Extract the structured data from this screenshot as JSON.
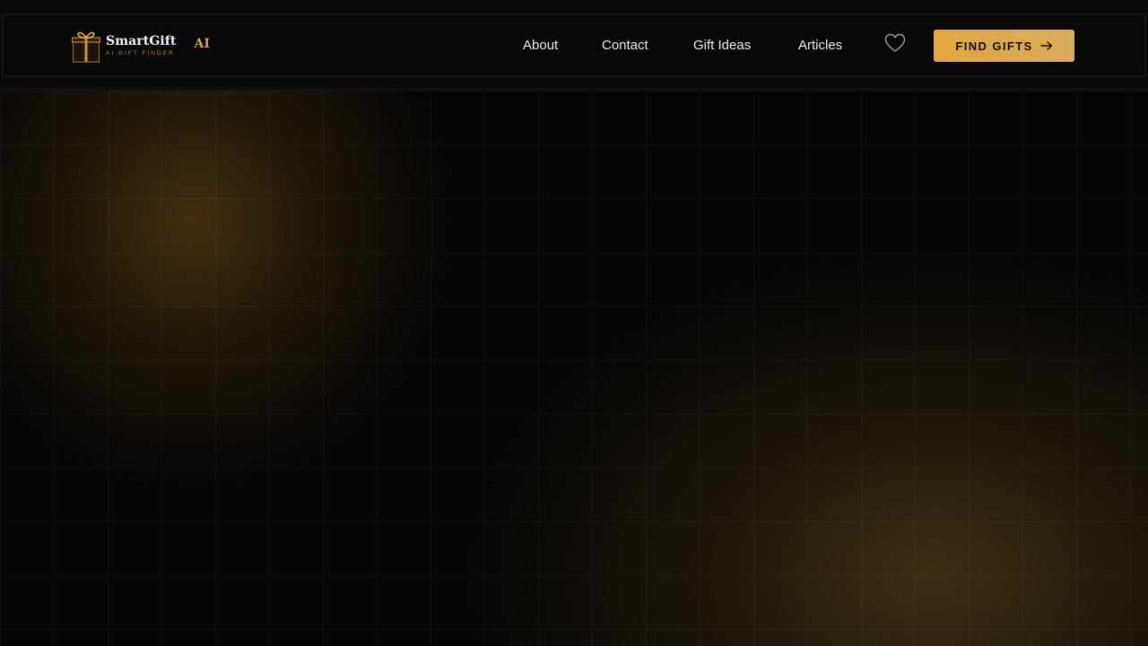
{
  "brand": {
    "name": "SmartGift",
    "tagline": "AI GIFT FINDER",
    "badge": "AI",
    "accent_color": "#d4a04a",
    "icon": "gift-box-icon"
  },
  "nav": {
    "items": [
      {
        "label": "About"
      },
      {
        "label": "Contact"
      },
      {
        "label": "Gift Ideas"
      },
      {
        "label": "Articles"
      }
    ],
    "favorites_icon": "heart-icon"
  },
  "cta": {
    "label": "FIND GIFTS",
    "icon": "arrow-right-icon",
    "color": "#e2a63e"
  }
}
